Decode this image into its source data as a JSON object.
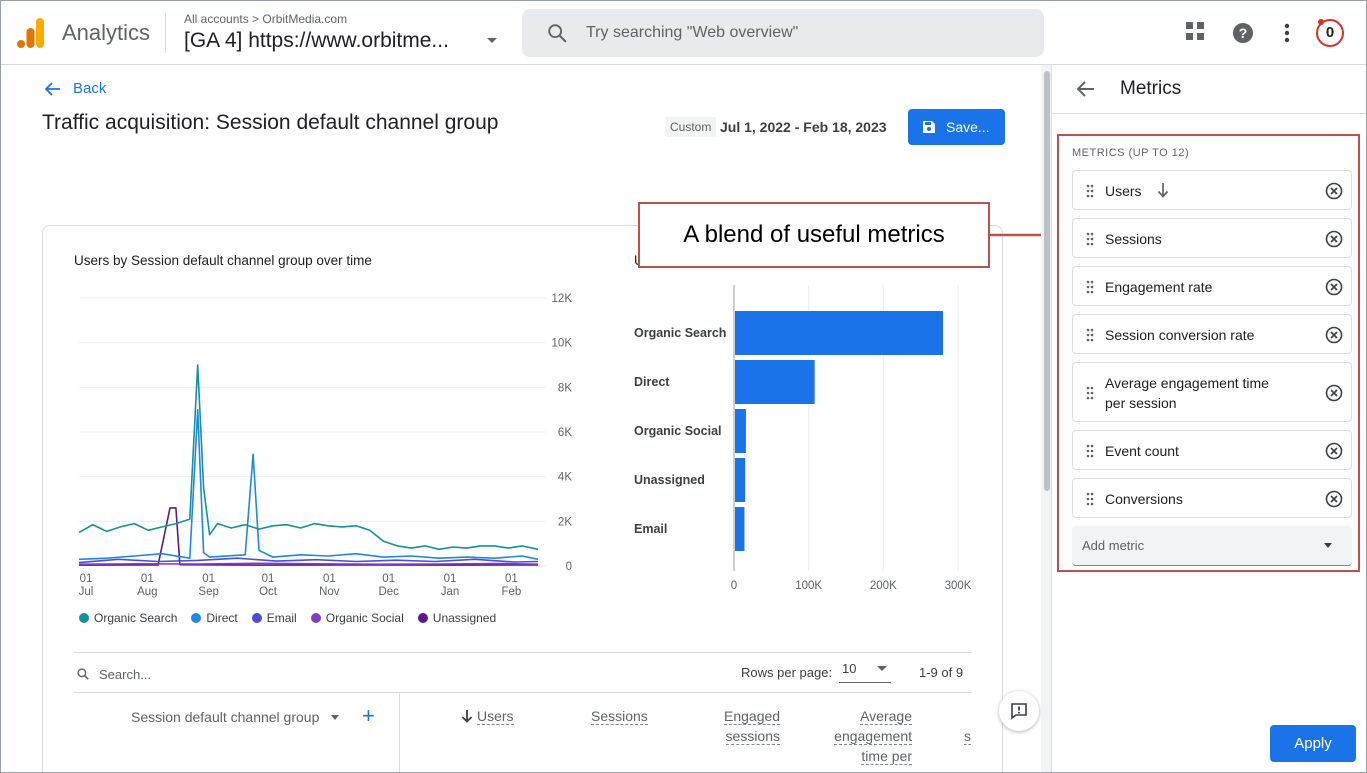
{
  "header": {
    "app_name": "Analytics",
    "account_crumb": "All accounts > OrbitMedia.com",
    "property": "[GA 4] https://www.orbitme...",
    "search_placeholder": "Try searching \"Web overview\"",
    "notification_count": "0"
  },
  "main": {
    "back_label": "Back",
    "title": "Traffic acquisition: Session default channel group",
    "date_badge": "Custom",
    "date_range": "Jul 1, 2022 - Feb 18, 2023",
    "save_label": "Save..."
  },
  "callout": {
    "text": "A blend of useful metrics"
  },
  "chart_data": [
    {
      "type": "line",
      "title": "Users by Session default channel group over time",
      "x_ticks": [
        [
          "01",
          "Jul"
        ],
        [
          "01",
          "Aug"
        ],
        [
          "01",
          "Sep"
        ],
        [
          "01",
          "Oct"
        ],
        [
          "01",
          "Nov"
        ],
        [
          "01",
          "Dec"
        ],
        [
          "01",
          "Jan"
        ],
        [
          "01",
          "Feb"
        ]
      ],
      "y_ticks": [
        "12K",
        "10K",
        "8K",
        "6K",
        "4K",
        "2K",
        "0"
      ],
      "ylim": [
        0,
        12000
      ],
      "x_range_days": [
        0,
        232
      ],
      "grid": true,
      "legend_position": "bottom",
      "series": [
        {
          "name": "Organic Search",
          "color": "#12939a",
          "points": [
            [
              0,
              1500
            ],
            [
              7,
              1850
            ],
            [
              14,
              1550
            ],
            [
              21,
              1750
            ],
            [
              28,
              1900
            ],
            [
              35,
              1600
            ],
            [
              42,
              1750
            ],
            [
              49,
              1900
            ],
            [
              56,
              2100
            ],
            [
              60,
              9000
            ],
            [
              63,
              3500
            ],
            [
              66,
              1400
            ],
            [
              70,
              1900
            ],
            [
              77,
              1700
            ],
            [
              84,
              1850
            ],
            [
              91,
              1650
            ],
            [
              98,
              1800
            ],
            [
              105,
              1850
            ],
            [
              112,
              1700
            ],
            [
              119,
              1900
            ],
            [
              126,
              1800
            ],
            [
              133,
              1750
            ],
            [
              140,
              1800
            ],
            [
              147,
              1600
            ],
            [
              154,
              1100
            ],
            [
              161,
              900
            ],
            [
              168,
              800
            ],
            [
              175,
              900
            ],
            [
              182,
              750
            ],
            [
              189,
              850
            ],
            [
              196,
              800
            ],
            [
              203,
              900
            ],
            [
              210,
              900
            ],
            [
              217,
              800
            ],
            [
              224,
              900
            ],
            [
              232,
              750
            ]
          ]
        },
        {
          "name": "Direct",
          "color": "#1e88e5",
          "points": [
            [
              0,
              300
            ],
            [
              14,
              350
            ],
            [
              28,
              450
            ],
            [
              42,
              550
            ],
            [
              56,
              350
            ],
            [
              60,
              7000
            ],
            [
              63,
              600
            ],
            [
              66,
              400
            ],
            [
              84,
              500
            ],
            [
              88,
              5000
            ],
            [
              91,
              700
            ],
            [
              98,
              400
            ],
            [
              112,
              500
            ],
            [
              126,
              450
            ],
            [
              140,
              550
            ],
            [
              154,
              400
            ],
            [
              168,
              450
            ],
            [
              182,
              350
            ],
            [
              196,
              400
            ],
            [
              210,
              350
            ],
            [
              224,
              450
            ],
            [
              232,
              300
            ]
          ]
        },
        {
          "name": "Email",
          "color": "#4a4fd8",
          "points": [
            [
              0,
              150
            ],
            [
              20,
              300
            ],
            [
              40,
              200
            ],
            [
              60,
              250
            ],
            [
              80,
              350
            ],
            [
              100,
              220
            ],
            [
              120,
              280
            ],
            [
              140,
              200
            ],
            [
              160,
              260
            ],
            [
              180,
              200
            ],
            [
              200,
              300
            ],
            [
              220,
              180
            ],
            [
              232,
              200
            ]
          ]
        },
        {
          "name": "Organic Social",
          "color": "#7e3fc4",
          "points": [
            [
              0,
              80
            ],
            [
              30,
              100
            ],
            [
              60,
              90
            ],
            [
              90,
              120
            ],
            [
              120,
              100
            ],
            [
              150,
              80
            ],
            [
              180,
              90
            ],
            [
              210,
              110
            ],
            [
              232,
              80
            ]
          ]
        },
        {
          "name": "Unassigned",
          "color": "#5e1a8a",
          "points": [
            [
              0,
              40
            ],
            [
              40,
              50
            ],
            [
              46,
              2600
            ],
            [
              49,
              2600
            ],
            [
              51,
              60
            ],
            [
              90,
              40
            ],
            [
              140,
              50
            ],
            [
              190,
              40
            ],
            [
              232,
              50
            ]
          ]
        }
      ]
    },
    {
      "type": "bar",
      "orientation": "horizontal",
      "categories": [
        "Organic Search",
        "Direct",
        "Organic Social",
        "Unassigned",
        "Email"
      ],
      "values": [
        280000,
        108000,
        16000,
        15000,
        14000
      ],
      "x_ticks": [
        "0",
        "100K",
        "200K",
        "300K"
      ],
      "xlim": [
        0,
        300000
      ],
      "color": "#1a73e8",
      "title_visible_fragment": "U"
    }
  ],
  "table": {
    "search_placeholder": "Search...",
    "rows_per_page_label": "Rows per page:",
    "rows_per_page_value": "10",
    "pager_text": "1-9 of 9",
    "dimension_header": "Session default channel group",
    "add_dimension": "+",
    "columns": {
      "users": "Users",
      "sessions": "Sessions",
      "engaged_line1": "Engaged",
      "engaged_line2": "sessions",
      "avg_line1": "Average",
      "avg_line2": "engagement",
      "avg_line3": "time per",
      "partial": "s"
    }
  },
  "panel": {
    "title": "Metrics",
    "caption": "METRICS (UP TO 12)",
    "metrics": [
      {
        "label": "Users"
      },
      {
        "label": "Sessions"
      },
      {
        "label": "Engagement rate"
      },
      {
        "label": "Session conversion rate"
      },
      {
        "label_line1": "Average engagement time",
        "label_line2": "per session"
      },
      {
        "label": "Event count"
      },
      {
        "label": "Conversions"
      }
    ],
    "add_metric_label": "Add metric",
    "apply_label": "Apply"
  },
  "colors": {
    "accent_blue": "#1a73e8",
    "highlight_red": "#c0504d"
  }
}
